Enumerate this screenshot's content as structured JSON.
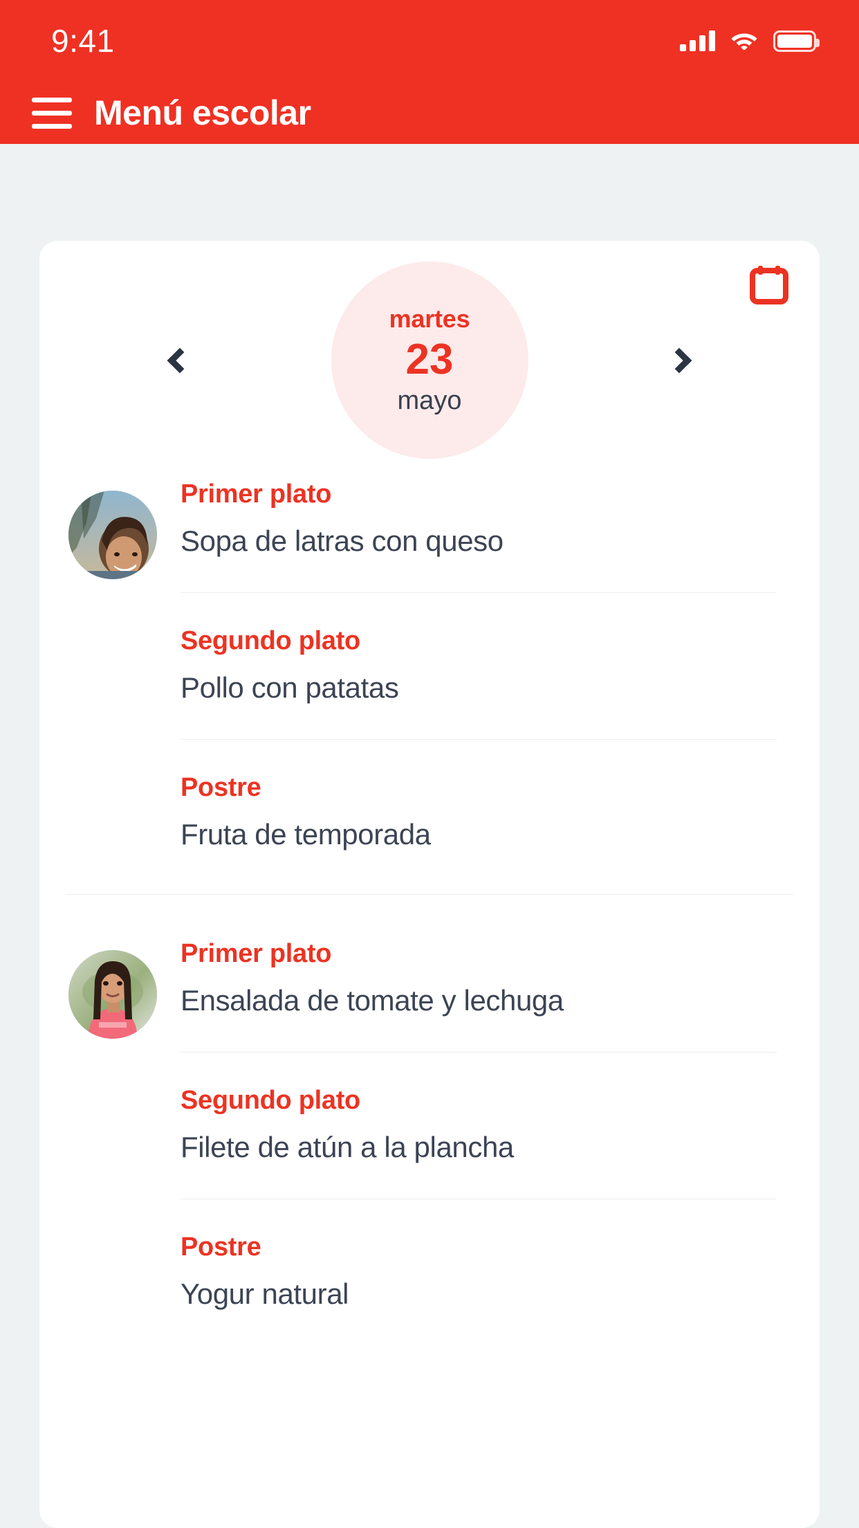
{
  "status_bar": {
    "time": "9:41",
    "signal_icon": "cellular-signal-icon",
    "wifi_icon": "wifi-icon",
    "battery_icon": "battery-full-icon"
  },
  "app_bar": {
    "menu_icon": "hamburger-menu-icon",
    "title": "Menú escolar"
  },
  "card": {
    "calendar_icon": "calendar-icon"
  },
  "date_selector": {
    "prev_label": "‹",
    "next_label": "›",
    "weekday": "martes",
    "day": "23",
    "month": "mayo"
  },
  "colors": {
    "brand_red": "#ef3123",
    "accent_red": "#ec3323",
    "circle_pink": "#fdeaea",
    "text_dark": "#3c4454",
    "page_bg": "#eef2f2",
    "card_bg": "#ffffff"
  },
  "menus": [
    {
      "avatar": "child-photo-boy-smiling",
      "dishes": [
        {
          "label": "Primer plato",
          "name": "Sopa de latras con queso"
        },
        {
          "label": "Segundo plato",
          "name": "Pollo con patatas"
        },
        {
          "label": "Postre",
          "name": "Fruta de temporada"
        }
      ]
    },
    {
      "avatar": "child-photo-girl-pink-shirt",
      "dishes": [
        {
          "label": "Primer plato",
          "name": "Ensalada de tomate y lechuga"
        },
        {
          "label": "Segundo plato",
          "name": "Filete de atún a la plancha"
        },
        {
          "label": "Postre",
          "name": "Yogur natural"
        }
      ]
    }
  ]
}
